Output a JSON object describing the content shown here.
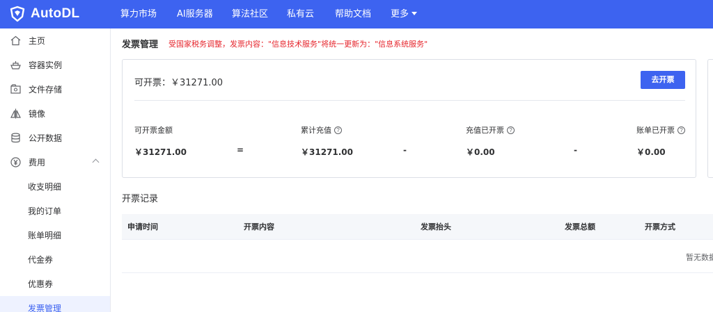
{
  "app": {
    "name": "AutoDL",
    "brand_color": "#3d63f0"
  },
  "topnav": {
    "items": [
      "算力市场",
      "AI服务器",
      "算法社区",
      "私有云",
      "帮助文档"
    ],
    "more": "更多"
  },
  "sidebar": {
    "items": [
      {
        "label": "主页",
        "icon": "home-icon"
      },
      {
        "label": "容器实例",
        "icon": "container-icon"
      },
      {
        "label": "文件存储",
        "icon": "storage-icon"
      },
      {
        "label": "镜像",
        "icon": "mirror-icon"
      },
      {
        "label": "公开数据",
        "icon": "database-icon"
      },
      {
        "label": "费用",
        "icon": "yen-icon",
        "expanded": true
      }
    ],
    "sub_items": [
      "收支明细",
      "我的订单",
      "账单明细",
      "代金券",
      "优惠券",
      "发票管理"
    ],
    "active": "发票管理"
  },
  "page": {
    "title": "发票管理",
    "notice": "受国家税务调整，发票内容：\"信息技术服务\"将统一更新为：\"信息系统服务\""
  },
  "summary": {
    "available_label": "可开票：",
    "available_value": "￥31271.00",
    "button": "去开票",
    "stats": [
      {
        "label": "可开票金额",
        "value": "￥31271.00",
        "help": false
      },
      {
        "label": "累计充值",
        "value": "￥31271.00",
        "help": true
      },
      {
        "label": "充值已开票",
        "value": "￥0.00",
        "help": true
      },
      {
        "label": "账单已开票",
        "value": "￥0.00",
        "help": true
      }
    ],
    "operators": [
      "=",
      "-",
      "-"
    ]
  },
  "records": {
    "title": "开票记录",
    "columns": [
      "申请时间",
      "开票内容",
      "发票抬头",
      "发票总额",
      "开票方式"
    ],
    "empty_text": "暂无数据"
  }
}
